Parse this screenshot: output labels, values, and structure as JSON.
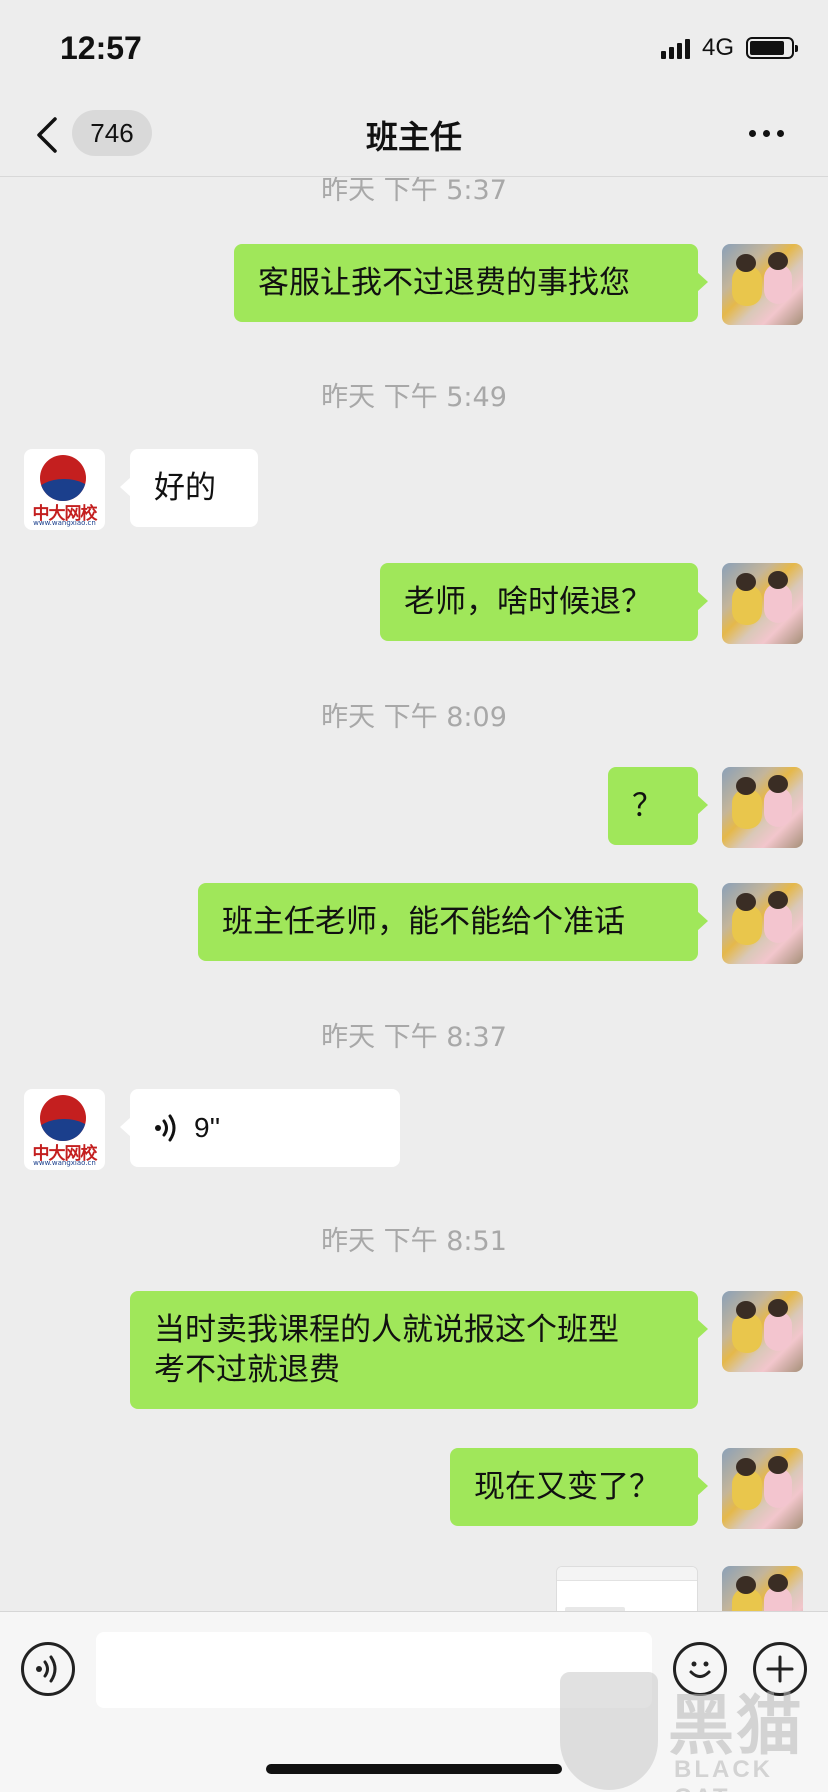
{
  "status_bar": {
    "time": "12:57",
    "network": "4G",
    "signal_bars": 4,
    "battery_level": 0.85
  },
  "nav": {
    "unread_count": "746",
    "title": "班主任"
  },
  "messages": [
    {
      "type": "timestamp",
      "text": "昨天 下午 5:37"
    },
    {
      "type": "text",
      "sender": "me",
      "text": "客服让我不过退费的事找您"
    },
    {
      "type": "timestamp",
      "text": "昨天 下午 5:49"
    },
    {
      "type": "text",
      "sender": "them",
      "text": "好的"
    },
    {
      "type": "text",
      "sender": "me",
      "text": "老师，啥时候退？"
    },
    {
      "type": "timestamp",
      "text": "昨天 下午 8:09"
    },
    {
      "type": "text",
      "sender": "me",
      "text": "？"
    },
    {
      "type": "text",
      "sender": "me",
      "text": "班主任老师，能不能给个准话"
    },
    {
      "type": "timestamp",
      "text": "昨天 下午 8:37"
    },
    {
      "type": "voice",
      "sender": "them",
      "duration": "9''"
    },
    {
      "type": "timestamp",
      "text": "昨天 下午 8:51"
    },
    {
      "type": "text",
      "sender": "me",
      "text": "当时卖我课程的人就说报这个班型\n考不过就退费"
    },
    {
      "type": "text",
      "sender": "me",
      "text": "现在又变了？"
    },
    {
      "type": "image",
      "sender": "me"
    }
  ],
  "contact_avatar": {
    "logo_text": "中大网校",
    "logo_url": "www.wangxiao.cn"
  },
  "watermark": {
    "cn": "黑猫",
    "en": "BLACK CAT"
  },
  "colors": {
    "my_bubble": "#a0e75a",
    "their_bubble": "#ffffff",
    "background": "#ededed",
    "timestamp": "#a8a8a8"
  }
}
